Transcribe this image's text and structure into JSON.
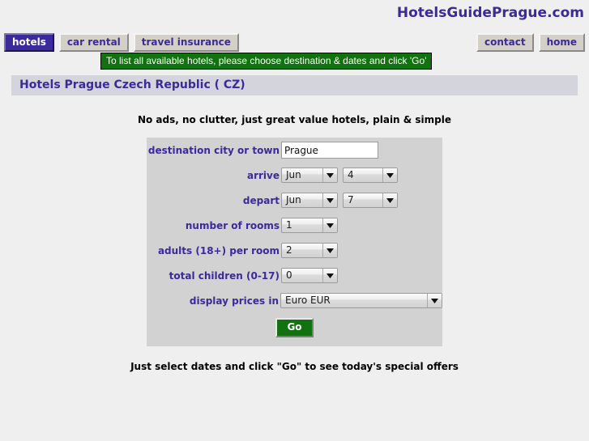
{
  "site": {
    "title": "HotelsGuidePrague.com",
    "brand_color": "#3a2a9b"
  },
  "nav": {
    "left_tabs": [
      {
        "label": "hotels",
        "active": true
      },
      {
        "label": "car rental",
        "active": false
      },
      {
        "label": "travel insurance",
        "active": false
      }
    ],
    "right_tabs": [
      {
        "label": "contact"
      },
      {
        "label": "home"
      }
    ]
  },
  "notice": {
    "text": "To list all available hotels, please choose destination & dates and click 'Go'",
    "bg_color": "#11720f",
    "text_color": "#ffffff"
  },
  "heading": {
    "text": "Hotels Prague Czech Republic ( CZ)"
  },
  "tagline": "No ads, no clutter, just great value hotels, plain & simple",
  "form": {
    "destination": {
      "label": "destination city or town",
      "value": "Prague",
      "placeholder": ""
    },
    "arrive": {
      "label": "arrive",
      "month": "Jun",
      "day": "4"
    },
    "depart": {
      "label": "depart",
      "month": "Jun",
      "day": "7"
    },
    "rooms": {
      "label": "number of rooms",
      "value": "1"
    },
    "adults": {
      "label": "adults (18+) per room",
      "value": "2"
    },
    "children": {
      "label": "total children (0-17)",
      "value": "0"
    },
    "currency": {
      "label": "display prices in",
      "value": "Euro EUR"
    },
    "submit": {
      "label": "Go"
    }
  },
  "footnote": "Just select dates and click \"Go\" to see today's special offers"
}
